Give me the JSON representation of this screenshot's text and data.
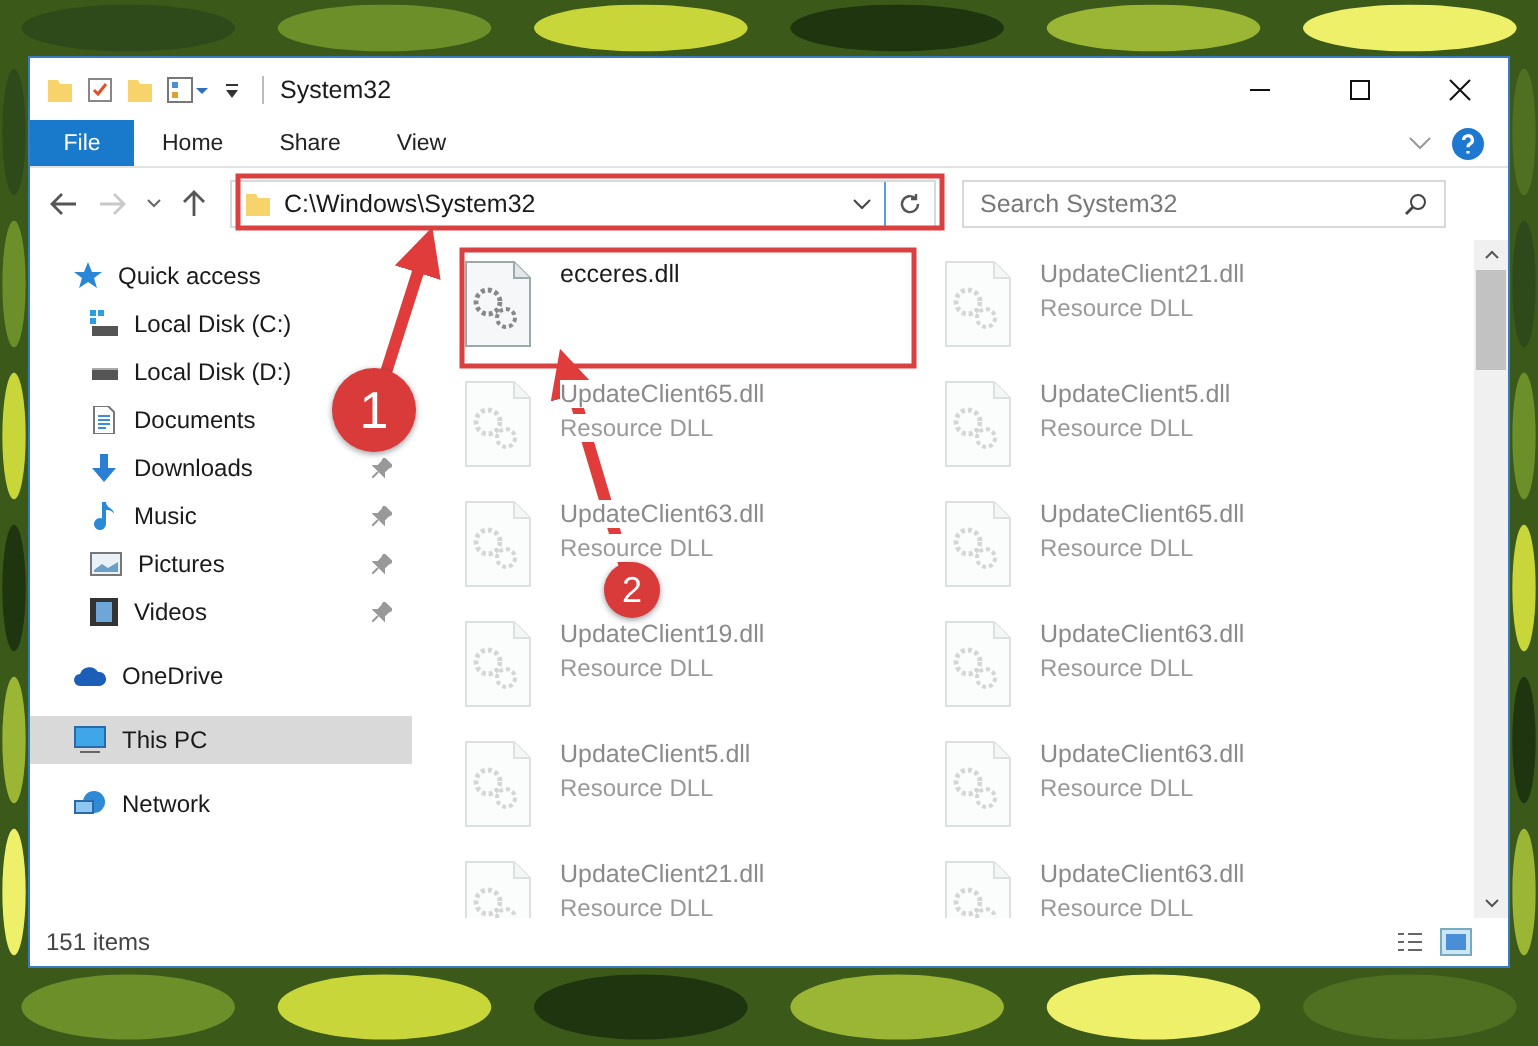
{
  "window": {
    "title": "System32"
  },
  "ribbon": {
    "tabs": [
      {
        "label": "File",
        "kind": "file"
      },
      {
        "label": "Home",
        "kind": "tab"
      },
      {
        "label": "Share",
        "kind": "tab"
      },
      {
        "label": "View",
        "kind": "tab"
      }
    ]
  },
  "address_bar": {
    "path": "C:\\Windows\\System32"
  },
  "search": {
    "placeholder": "Search System32"
  },
  "sidebar": {
    "items": [
      {
        "label": "Quick access",
        "kind": "star",
        "selected": false,
        "children": [
          {
            "label": "Local Disk (C:)",
            "kind": "disk-c",
            "pinned": false,
            "selected": false
          },
          {
            "label": "Local Disk (D:)",
            "kind": "disk",
            "pinned": false,
            "selected": false
          },
          {
            "label": "Documents",
            "kind": "documents",
            "pinned": false,
            "selected": false
          },
          {
            "label": "Downloads",
            "kind": "downloads",
            "pinned": true,
            "selected": false
          },
          {
            "label": "Music",
            "kind": "music",
            "pinned": true,
            "selected": false
          },
          {
            "label": "Pictures",
            "kind": "pictures",
            "pinned": true,
            "selected": false
          },
          {
            "label": "Videos",
            "kind": "videos",
            "pinned": true,
            "selected": false
          }
        ]
      },
      {
        "label": "OneDrive",
        "kind": "cloud",
        "selected": false
      },
      {
        "label": "This PC",
        "kind": "pc",
        "selected": true
      },
      {
        "label": "Network",
        "kind": "network",
        "selected": false
      }
    ]
  },
  "files": [
    {
      "name": "ecceres.dll",
      "faded": false
    },
    {
      "name": "UpdateClient21.dll",
      "type": "Resource DLL",
      "faded": true
    },
    {
      "name": "UpdateClient65.dll",
      "type": "Resource DLL",
      "faded": true
    },
    {
      "name": "UpdateClient5.dll",
      "type": "Resource DLL",
      "faded": true
    },
    {
      "name": "UpdateClient63.dll",
      "type": "Resource DLL",
      "faded": true
    },
    {
      "name": "UpdateClient65.dll",
      "type": "Resource DLL",
      "faded": true
    },
    {
      "name": "UpdateClient19.dll",
      "type": "Resource DLL",
      "faded": true
    },
    {
      "name": "UpdateClient63.dll",
      "type": "Resource DLL",
      "faded": true
    },
    {
      "name": "UpdateClient5.dll",
      "type": "Resource DLL",
      "faded": true
    },
    {
      "name": "UpdateClient63.dll",
      "type": "Resource DLL",
      "faded": true
    },
    {
      "name": "UpdateClient21.dll",
      "type": "Resource DLL",
      "faded": true
    },
    {
      "name": "UpdateClient63.dll",
      "type": "Resource DLL",
      "faded": true
    }
  ],
  "annotations": [
    {
      "label": "1"
    },
    {
      "label": "2"
    }
  ],
  "status_bar": {
    "item_count": "151 items"
  }
}
